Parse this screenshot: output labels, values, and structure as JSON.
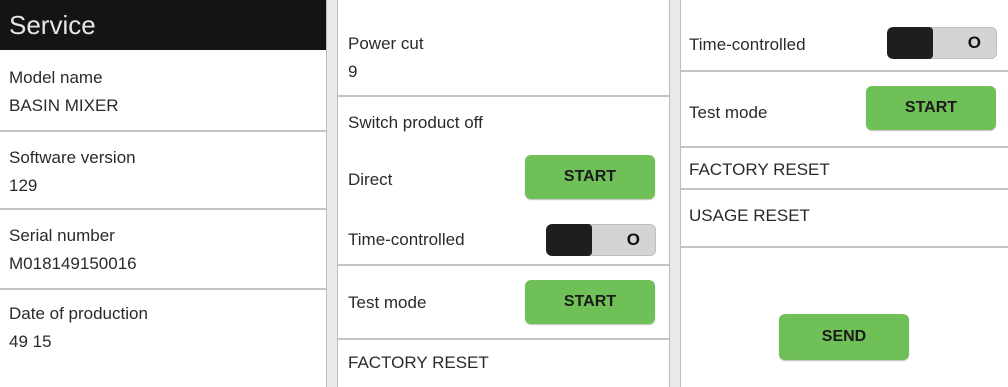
{
  "screen1": {
    "header": "Service",
    "model_label": "Model name",
    "model_value": "BASIN MIXER",
    "software_label": "Software version",
    "software_value": "129",
    "serial_label": "Serial number",
    "serial_value": "M018149150016",
    "production_label": "Date of production",
    "production_value": "49 15"
  },
  "screen2": {
    "powercut_label": "Power cut",
    "powercut_value": "9",
    "switch_off_label": "Switch product off",
    "direct_label": "Direct",
    "direct_button": "START",
    "timed_label": "Time-controlled",
    "timed_state": "O",
    "testmode_label": "Test mode",
    "testmode_button": "START",
    "factory_reset": "FACTORY RESET"
  },
  "screen3": {
    "timed_label": "Time-controlled",
    "timed_state": "O",
    "testmode_label": "Test mode",
    "testmode_button": "START",
    "factory_reset": "FACTORY RESET",
    "usage_reset": "USAGE RESET",
    "send_button": "SEND"
  },
  "colors": {
    "accent_green": "#6fc056",
    "header_bg": "#141414",
    "toggle_knob": "#1e1e1e"
  }
}
